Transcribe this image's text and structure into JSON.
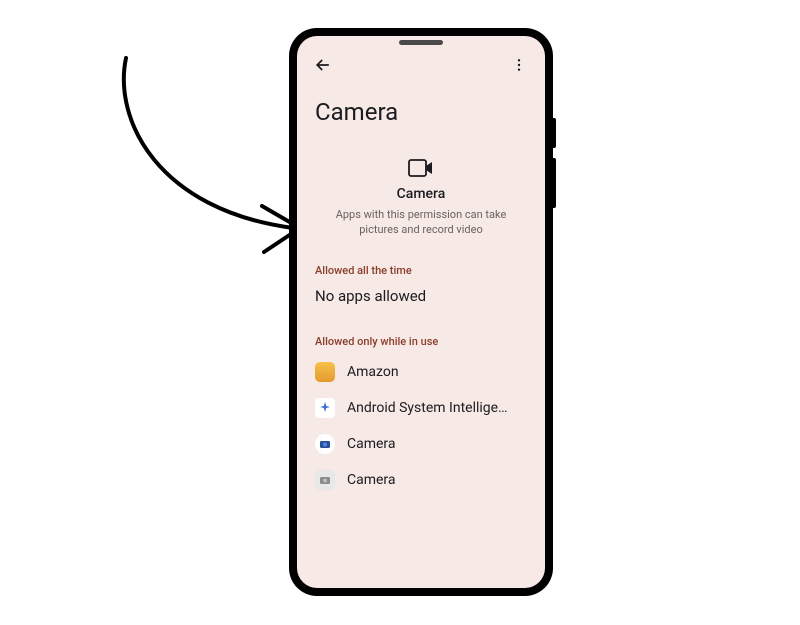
{
  "page": {
    "title": "Camera"
  },
  "permission": {
    "icon_name": "camera-icon",
    "label": "Camera",
    "description": "Apps with this permission can take pictures and record video"
  },
  "sections": {
    "allowed_all": {
      "header": "Allowed all the time",
      "no_apps_text": "No apps allowed"
    },
    "allowed_in_use": {
      "header": "Allowed only while in use",
      "apps": [
        {
          "name": "Amazon"
        },
        {
          "name": "Android System Intellige…"
        },
        {
          "name": "Camera"
        },
        {
          "name": "Camera"
        }
      ]
    }
  }
}
